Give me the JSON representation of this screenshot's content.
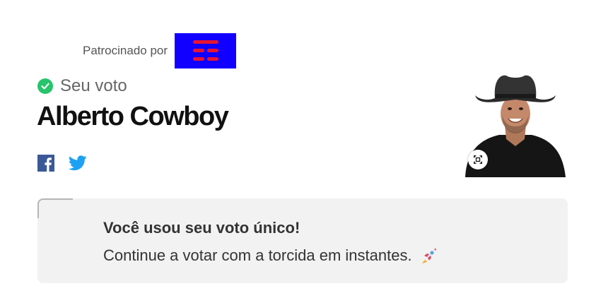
{
  "sponsor": {
    "label": "Patrocinado por",
    "logo_color": "#1100ff",
    "logo_mark_color": "#e8142f"
  },
  "vote": {
    "status_label": "Seu voto",
    "check_color": "#27c46b",
    "candidate_name": "Alberto Cowboy"
  },
  "share": {
    "facebook_icon": "facebook-icon",
    "twitter_icon": "twitter-icon"
  },
  "photo": {
    "expand_icon": "expand-icon"
  },
  "notice": {
    "title": "Você usou seu voto único!",
    "message": "Continue a votar com a torcida em instantes.",
    "emoji_icon": "rocket-icon"
  }
}
